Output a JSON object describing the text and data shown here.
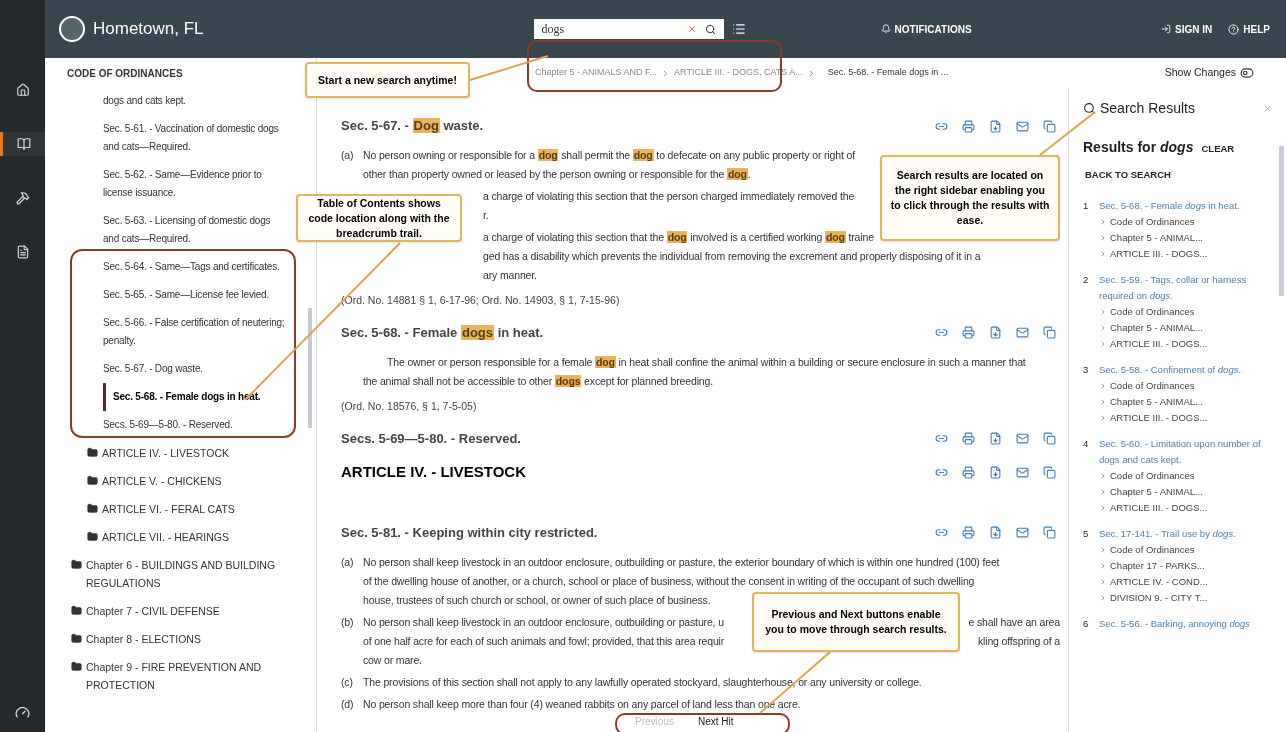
{
  "header": {
    "site_title": "Hometown, FL",
    "search": {
      "value": "dogs"
    },
    "notifications": "NOTIFICATIONS",
    "sign_in": "SIGN IN",
    "help": "HELP"
  },
  "rail": [
    {
      "selected": false
    },
    {
      "selected": true
    },
    {
      "selected": false
    },
    {
      "selected": false
    }
  ],
  "toc": {
    "title": "CODE OF ORDINANCES",
    "tree": [
      {
        "children": [
          {
            "children": [
              {
                "label": "dogs and cats kept.",
                "selected": false
              },
              {
                "label": "Sec. 5-61. - Vaccination of domestic dogs and cats—Required.",
                "selected": false
              },
              {
                "label": "Sec. 5-62. - Same—Evidence prior to license issuance.",
                "selected": false
              },
              {
                "label": "Sec. 5-63. - Licensing of domestic dogs and cats—Required.",
                "selected": false
              },
              {
                "label": "Sec. 5-64. - Same—Tags and certificates.",
                "selected": false
              },
              {
                "label": "Sec. 5-65. - Same—License fee levied.",
                "selected": false
              },
              {
                "label": "Sec. 5-66. - False certification of neutering; penalty.",
                "selected": false
              },
              {
                "label": "Sec. 5-67. - Dog waste.",
                "selected": false
              },
              {
                "label": "Sec. 5-68. - Female dogs in heat.",
                "selected": true
              },
              {
                "label": "Secs. 5-69—5-80. - Reserved.",
                "selected": false
              }
            ]
          },
          {
            "label": "ARTICLE IV. - LIVESTOCK",
            "selected": false
          },
          {
            "label": "ARTICLE V. - CHICKENS",
            "selected": false
          },
          {
            "label": "ARTICLE VI. - FERAL CATS",
            "selected": false
          },
          {
            "label": "ARTICLE VII. - HEARINGS",
            "selected": false
          }
        ]
      },
      {
        "label": "Chapter 6 - BUILDINGS AND BUILDING REGULATIONS",
        "selected": false
      },
      {
        "label": "Chapter 7 - CIVIL DEFENSE",
        "selected": false
      },
      {
        "label": "Chapter 8 - ELECTIONS",
        "selected": false
      },
      {
        "label": "Chapter 9 - FIRE PREVENTION AND PROTECTION",
        "selected": false
      }
    ]
  },
  "breadcrumb": [
    "Chapter 5 - ANIMALS AND F...",
    "ARTICLE III. - DOGS, CATS A...",
    "Sec. 5-68. - Female dogs in ..."
  ],
  "show_changes": {
    "label": "Show Changes",
    "on": false
  },
  "sections": [
    {
      "kind": "section",
      "heading": "Sec. 5-67. - **Dog** waste.",
      "paragraphs": [
        {
          "label": "(a)",
          "lines": [
            {
              "kind": "plain",
              "parts": [
                "No person owning or responsible for a **dog** shall permit the **dog** to defecate on any public property or right of"
              ]
            },
            {
              "kind": "plain",
              "parts": [
                "other than property owned or leased by the person owning or responsible for the **dog**."
              ]
            }
          ]
        },
        {
          "lines": [
            {
              "kind": "covered",
              "parts": [
                "a charge of violating this section that the person charged immediately removed the"
              ]
            },
            {
              "kind": "covered",
              "parts": [
                "r."
              ]
            }
          ]
        },
        {
          "lines": [
            {
              "kind": "covered",
              "parts": [
                "a charge of violating this section that the **dog** involved is a certified working **dog** traine"
              ]
            },
            {
              "kind": "covered",
              "parts": [
                "ged has a disability which prevents the individual from removing the excrement and properly disposing of it in a"
              ]
            },
            {
              "kind": "covered",
              "parts": [
                "ary manner."
              ]
            }
          ]
        }
      ],
      "history": "(Ord. No. 14881 § 1, 6-17-96; Ord. No. 14903, § 1, 7-15-96)"
    },
    {
      "kind": "section",
      "heading": "Sec. 5-68. - Female **dogs** in heat.",
      "paragraphs": [
        {
          "lines": [
            {
              "kind": "indent",
              "parts": [
                "The owner or person responsible for a female **dog** in heat shall confine the animal within a building or secure enclosure in such a manner that"
              ]
            },
            {
              "kind": "plain",
              "parts": [
                "the animal shall not be accessible to other **dogs** except for planned breeding."
              ]
            }
          ]
        }
      ],
      "history": "(Ord. No. 18576, § 1, 7-5-05)"
    },
    {
      "kind": "section",
      "heading": "Secs. 5-69—5-80. - Reserved."
    },
    {
      "kind": "article",
      "heading": "ARTICLE IV. - LIVESTOCK"
    },
    {
      "kind": "section",
      "heading": "Sec. 5-81. - Keeping within city restricted.",
      "paragraphs": [
        {
          "label": "(a)",
          "lines": [
            {
              "kind": "plain",
              "parts": [
                "No person shall keep livestock in an outdoor enclosure, outbuilding or pasture, the exterior boundary of which is within one hundred (100) feet"
              ]
            },
            {
              "kind": "plain",
              "parts": [
                "of the dwelling house of another, or a church, school or place of business, without the consent in writing of the occupant of such dwelling"
              ]
            },
            {
              "kind": "plain",
              "parts": [
                "house, trustees of such church or school, or owner of such place of business."
              ]
            }
          ]
        },
        {
          "label": "(b)",
          "lines": [
            {
              "kind": "plain",
              "parts": [
                "No person shall keep livestock in an outdoor enclosure, outbuilding or pasture, u",
                "e shall have an area"
              ]
            },
            {
              "kind": "plain",
              "parts": [
                "of one half acre for each of such animals and fowl; provided, that this area requir",
                "kling offspring of a"
              ]
            },
            {
              "kind": "plain",
              "parts": [
                "cow or mare."
              ]
            }
          ]
        },
        {
          "label": "(c)",
          "lines": [
            {
              "kind": "plain",
              "parts": [
                "The provisions of this section shall not apply to any lawfully operated stockyard, slaughterhouse, or any university or college."
              ]
            }
          ]
        },
        {
          "label": "(d)",
          "lines": [
            {
              "kind": "plain",
              "parts": [
                "No person shall keep more than four (4) weaned rabbits on any parcel of land less than one acre."
              ]
            }
          ]
        }
      ]
    }
  ],
  "hit_nav": {
    "previous": {
      "label": "Previous",
      "disabled": true
    },
    "next": {
      "label": "Next Hit",
      "disabled": false
    }
  },
  "results": {
    "title": "Search Results",
    "heading": "Results for *dogs*",
    "clear": "CLEAR",
    "back": "BACK TO SEARCH",
    "items": [
      {
        "number": "1",
        "link": "Sec. 5-68. - Female *dogs* in heat.",
        "path": [
          "Code of Ordinances",
          "Chapter 5 - ANIMAL...",
          "ARTICLE III. - DOGS..."
        ]
      },
      {
        "number": "2",
        "link": "Sec. 5-59. - Tags, collar or harness required on *dogs*.",
        "path": [
          "Code of Ordinances",
          "Chapter 5 - ANIMAL...",
          "ARTICLE III. - DOGS..."
        ]
      },
      {
        "number": "3",
        "link": "Sec. 5-58. - Confinement of *dogs*.",
        "path": [
          "Code of Ordinances",
          "Chapter 5 - ANIMAL...",
          "ARTICLE III. - DOGS..."
        ]
      },
      {
        "number": "4",
        "link": "Sec. 5-60. - Limitation upon number of dogs and cats kept.",
        "path": [
          "Code of Ordinances",
          "Chapter 5 - ANIMAL...",
          "ARTICLE III. - DOGS..."
        ]
      },
      {
        "number": "5",
        "link": "Sec. 17-141. - Trail use by *dogs*.",
        "path": [
          "Code of Ordinances",
          "Chapter 17 - PARKS...",
          "ARTICLE IV. - COND...",
          "DIVISION 9. - CITY T..."
        ]
      },
      {
        "number": "6",
        "link": "Sec. 5-56. - Barking, annoying *dogs*"
      }
    ]
  },
  "callouts": [
    {
      "text": "Start a new search anytime!"
    },
    {
      "text": "Table of Contents shows code location along with the breadcrumb trail."
    },
    {
      "text": "Search results are located on the right sidebar enabling you to click through the results with ease."
    },
    {
      "text": "Previous and Next buttons enable you to move through search results."
    }
  ]
}
